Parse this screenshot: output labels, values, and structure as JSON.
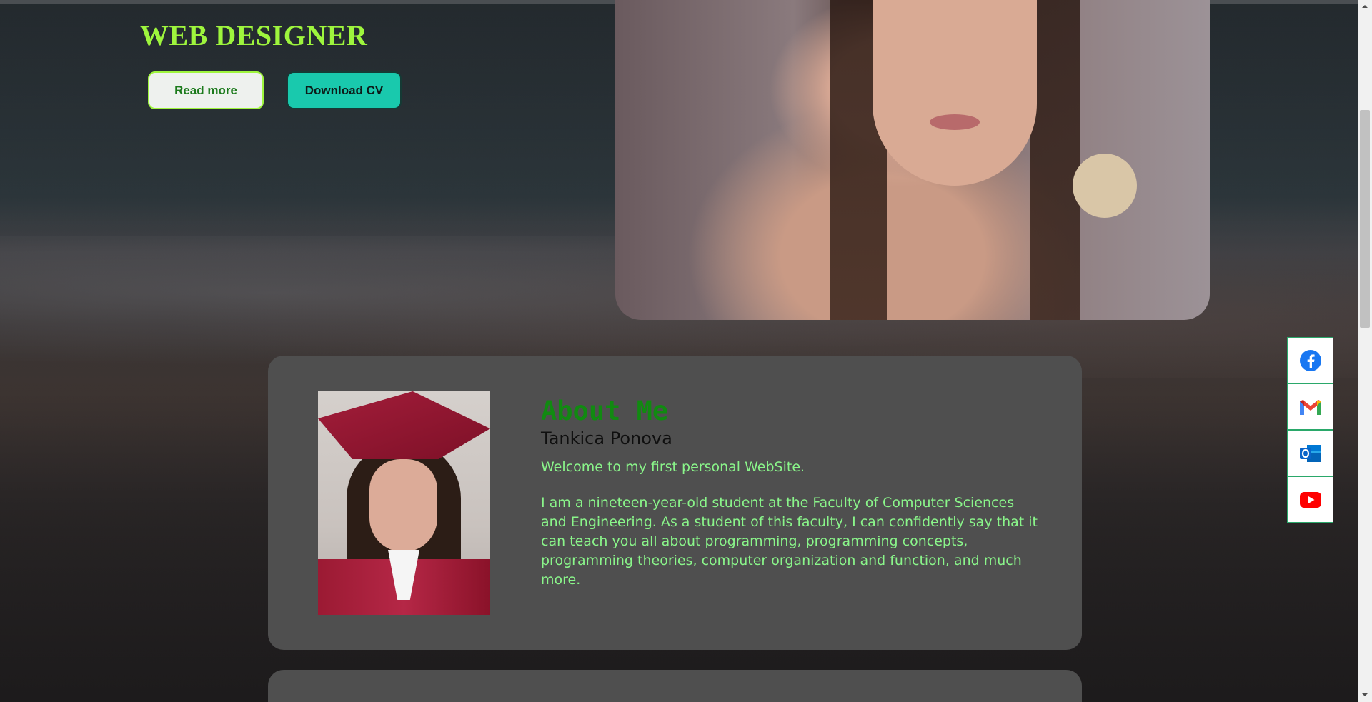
{
  "hero": {
    "title": "WEB DESIGNER",
    "read_more_label": "Read more",
    "download_cv_label": "Download CV"
  },
  "about": {
    "title": "About Me",
    "name": "Tankica Ponova",
    "welcome": "Welcome to my first personal WebSite.",
    "bio": "I am a nineteen-year-old student at the Faculty of Computer Sciences and Engineering. As a student of this faculty, I can confidently say that it can teach you all about programming, programming concepts, programming theories, computer organization and function, and much more."
  },
  "social": [
    {
      "icon": "facebook-icon",
      "color": "#1877f2"
    },
    {
      "icon": "gmail-icon",
      "color": "#ea4335"
    },
    {
      "icon": "outlook-icon",
      "color": "#0a64c9"
    },
    {
      "icon": "youtube-icon",
      "color": "#ff0000"
    }
  ],
  "colors": {
    "accent_green": "#9ef53d",
    "text_green": "#8af58a",
    "heading_green": "#118a11",
    "teal_button": "#19c9ad",
    "card_bg": "#4f4f4f"
  }
}
